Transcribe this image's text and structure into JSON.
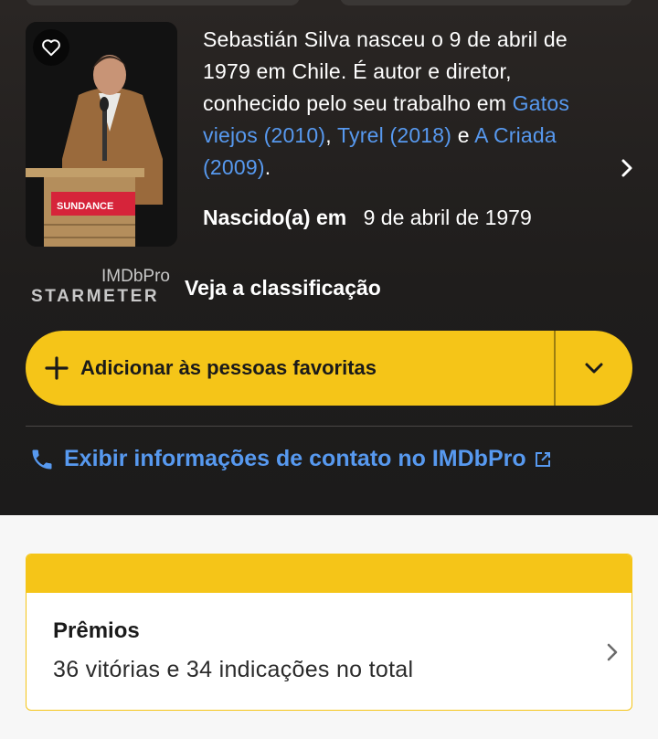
{
  "bio": {
    "text_1": "Sebastián Silva nasceu o 9 de abril de 1979 em Chile. É autor e diretor, conhecido pelo seu trabalho em ",
    "link_1": "Gatos viejos (2010)",
    "sep_1": ", ",
    "link_2": "Tyrel (2018)",
    "sep_2": " e ",
    "link_3": "A Criada (2009)",
    "end": ".",
    "photo_sign": "SUNDANCE"
  },
  "born": {
    "label": "Nascido(a) em",
    "value": "9 de abril de 1979"
  },
  "starmeter": {
    "pro_label": "IMDbPro",
    "label": "STARMETER",
    "link": "Veja a classificação"
  },
  "favorites": {
    "label": "Adicionar às pessoas favoritas"
  },
  "contact": {
    "label": "Exibir informações de contato no IMDbPro"
  },
  "awards": {
    "title": "Prêmios",
    "summary": "36 vitórias e 34 indicações no total"
  },
  "icons": {
    "favorite": "heart-outline-icon",
    "next": "chevron-right-icon",
    "add": "plus-icon",
    "dropdown": "chevron-down-icon",
    "phone": "phone-icon",
    "external": "external-link-icon",
    "awards_next": "chevron-right-icon"
  },
  "colors": {
    "accent": "#f5c518",
    "link": "#5799ef",
    "hero_bg": "#1f1d1c",
    "page_bg": "#f7f7f7"
  }
}
